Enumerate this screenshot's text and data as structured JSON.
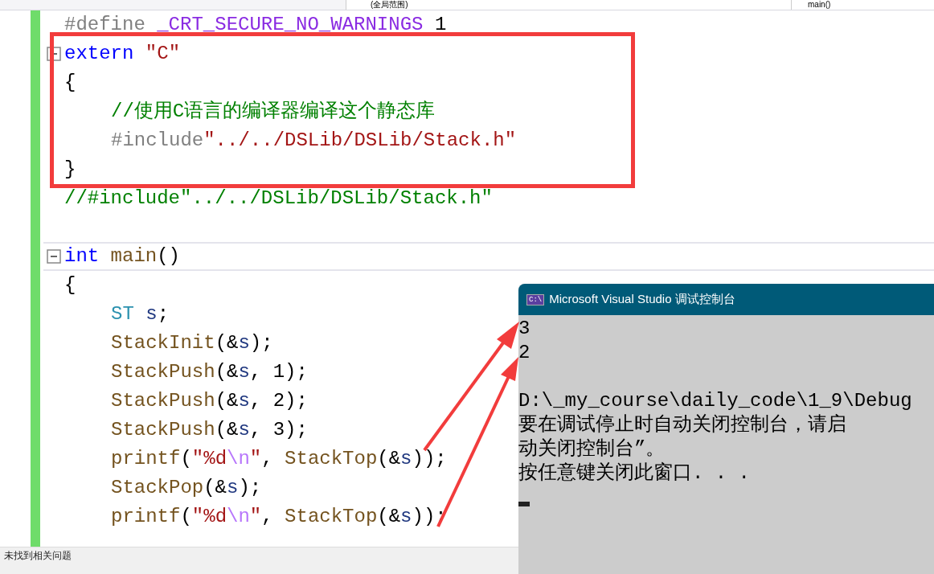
{
  "header": {
    "scope_dropdown": "(全局范围)",
    "member_dropdown": "main()"
  },
  "editor": {
    "lines": [
      {
        "fold_box": false,
        "indented": false,
        "current": false,
        "tokens": [
          {
            "kind": "preprocessor",
            "text": "#define "
          },
          {
            "kind": "macro",
            "text": "_CRT_SECURE_NO_WARNINGS"
          },
          {
            "kind": "number",
            "text": " 1"
          }
        ]
      },
      {
        "fold_box": true,
        "indented": false,
        "current": false,
        "tokens": [
          {
            "kind": "keyword",
            "text": "extern "
          },
          {
            "kind": "string",
            "text": "\"C\""
          }
        ]
      },
      {
        "fold_box": false,
        "indented": false,
        "current": false,
        "tokens": [
          {
            "kind": "plain",
            "text": "{"
          }
        ]
      },
      {
        "fold_box": false,
        "indented": true,
        "current": false,
        "tokens": [
          {
            "kind": "comment",
            "text": "//使用C语言的编译器编译这个静态库"
          }
        ]
      },
      {
        "fold_box": false,
        "indented": true,
        "current": false,
        "tokens": [
          {
            "kind": "preprocessor",
            "text": "#include"
          },
          {
            "kind": "string",
            "text": "\"../../DSLib/DSLib/Stack.h\""
          }
        ]
      },
      {
        "fold_box": false,
        "indented": false,
        "current": false,
        "tokens": [
          {
            "kind": "plain",
            "text": "}"
          }
        ]
      },
      {
        "fold_box": false,
        "indented": false,
        "current": false,
        "tokens": [
          {
            "kind": "comment",
            "text": "//#include\"../../DSLib/DSLib/Stack.h\""
          }
        ]
      },
      {
        "fold_box": false,
        "current": false
      },
      {
        "fold_box": true,
        "indented": false,
        "current": true,
        "tokens": [
          {
            "kind": "keyword",
            "text": "int "
          },
          {
            "kind": "function",
            "text": "main"
          },
          {
            "kind": "plain",
            "text": "()"
          }
        ]
      },
      {
        "fold_box": false,
        "indented": false,
        "current": false,
        "tokens": [
          {
            "kind": "plain",
            "text": "{"
          }
        ]
      },
      {
        "fold_box": false,
        "indented": true,
        "current": false,
        "tokens": [
          {
            "kind": "type",
            "text": "ST"
          },
          {
            "kind": "variable",
            "text": " s"
          },
          {
            "kind": "plain",
            "text": ";"
          }
        ]
      },
      {
        "fold_box": false,
        "indented": true,
        "current": false,
        "tokens": [
          {
            "kind": "function",
            "text": "StackInit"
          },
          {
            "kind": "plain",
            "text": "(&"
          },
          {
            "kind": "variable",
            "text": "s"
          },
          {
            "kind": "plain",
            "text": ");"
          }
        ]
      },
      {
        "fold_box": false,
        "indented": true,
        "current": false,
        "tokens": [
          {
            "kind": "function",
            "text": "StackPush"
          },
          {
            "kind": "plain",
            "text": "(&"
          },
          {
            "kind": "variable",
            "text": "s"
          },
          {
            "kind": "plain",
            "text": ", 1);"
          }
        ]
      },
      {
        "fold_box": false,
        "indented": true,
        "current": false,
        "tokens": [
          {
            "kind": "function",
            "text": "StackPush"
          },
          {
            "kind": "plain",
            "text": "(&"
          },
          {
            "kind": "variable",
            "text": "s"
          },
          {
            "kind": "plain",
            "text": ", 2);"
          }
        ]
      },
      {
        "fold_box": false,
        "indented": true,
        "current": false,
        "tokens": [
          {
            "kind": "function",
            "text": "StackPush"
          },
          {
            "kind": "plain",
            "text": "(&"
          },
          {
            "kind": "variable",
            "text": "s"
          },
          {
            "kind": "plain",
            "text": ", 3);"
          }
        ]
      },
      {
        "fold_box": false,
        "indented": true,
        "current": false,
        "tokens": [
          {
            "kind": "function",
            "text": "printf"
          },
          {
            "kind": "plain",
            "text": "("
          },
          {
            "kind": "string",
            "text": "\"%d"
          },
          {
            "kind": "escape",
            "text": "\\n"
          },
          {
            "kind": "string",
            "text": "\""
          },
          {
            "kind": "plain",
            "text": ", "
          },
          {
            "kind": "function",
            "text": "StackTop"
          },
          {
            "kind": "plain",
            "text": "(&"
          },
          {
            "kind": "variable",
            "text": "s"
          },
          {
            "kind": "plain",
            "text": "));"
          }
        ]
      },
      {
        "fold_box": false,
        "indented": true,
        "current": false,
        "tokens": [
          {
            "kind": "function",
            "text": "StackPop"
          },
          {
            "kind": "plain",
            "text": "(&"
          },
          {
            "kind": "variable",
            "text": "s"
          },
          {
            "kind": "plain",
            "text": ");"
          }
        ]
      },
      {
        "fold_box": false,
        "indented": true,
        "current": false,
        "tokens": [
          {
            "kind": "function",
            "text": "printf"
          },
          {
            "kind": "plain",
            "text": "("
          },
          {
            "kind": "string",
            "text": "\"%d"
          },
          {
            "kind": "escape",
            "text": "\\n"
          },
          {
            "kind": "string",
            "text": "\""
          },
          {
            "kind": "plain",
            "text": ", "
          },
          {
            "kind": "function",
            "text": "StackTop"
          },
          {
            "kind": "plain",
            "text": "(&"
          },
          {
            "kind": "variable",
            "text": "s"
          },
          {
            "kind": "plain",
            "text": "));"
          }
        ]
      }
    ]
  },
  "status_bar": {
    "message": "未找到相关问题"
  },
  "console": {
    "title": "Microsoft Visual Studio 调试控制台",
    "icon_text": "C:\\",
    "output": [
      "3",
      "2"
    ],
    "messages": [
      "D:\\_my_course\\daily_code\\1_9\\Debug",
      "要在调试停止时自动关闭控制台，请启",
      "动关闭控制台”。",
      "按任意键关闭此窗口. . ."
    ]
  }
}
